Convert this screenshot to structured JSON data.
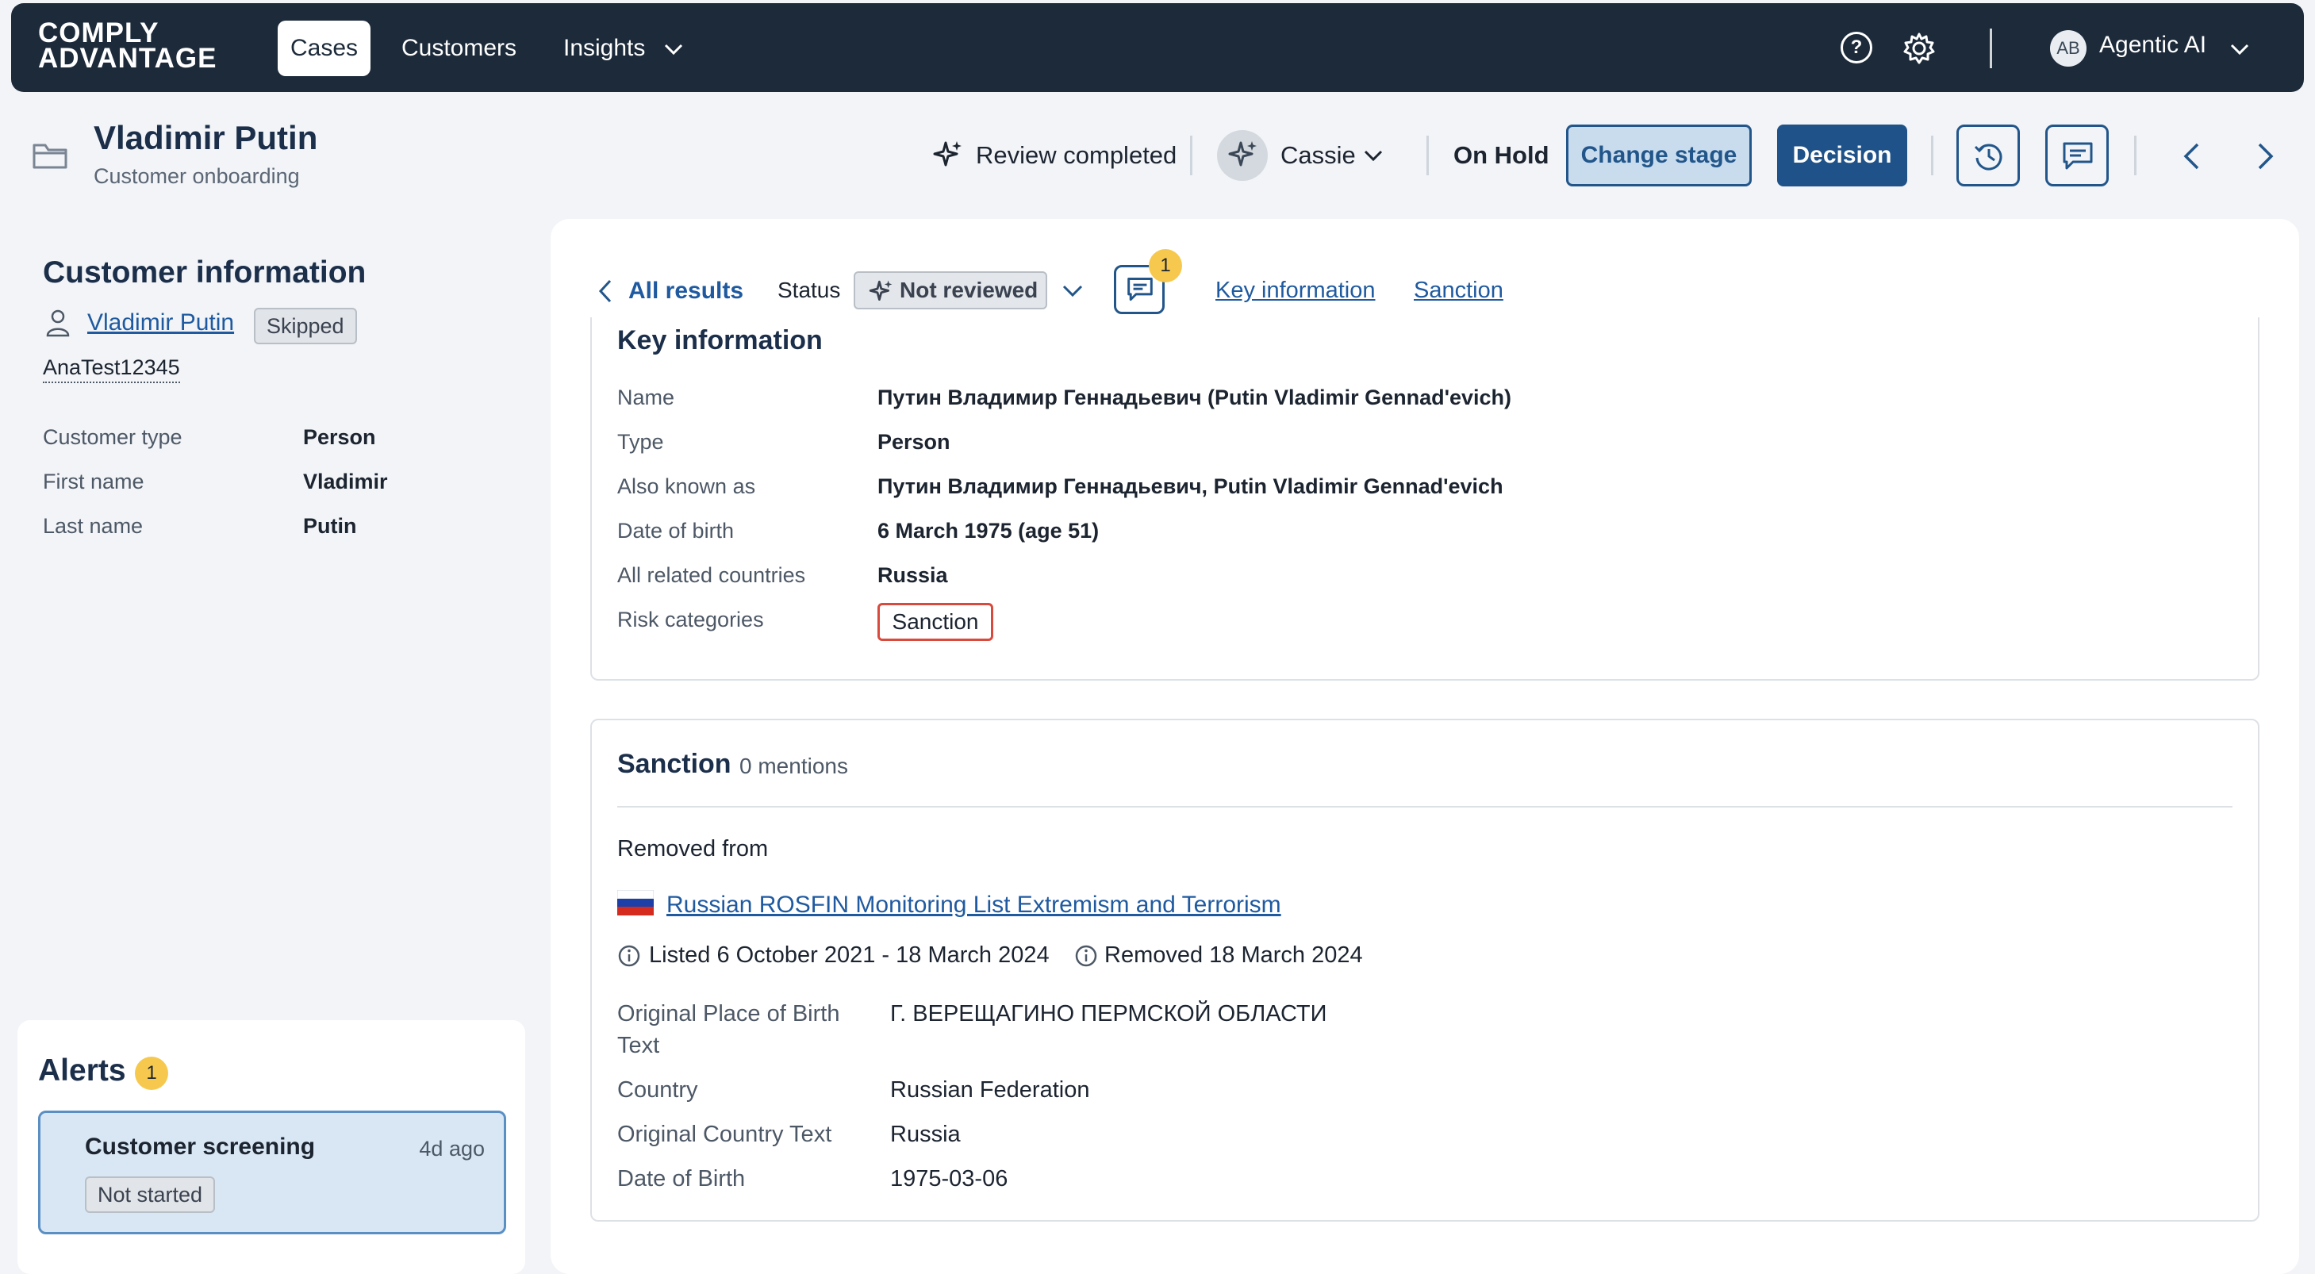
{
  "nav": {
    "logo_line1": "COMPLY",
    "logo_line2": "ADVANTAGE",
    "tabs": [
      {
        "label": "Cases",
        "active": true
      },
      {
        "label": "Customers",
        "active": false
      },
      {
        "label": "Insights",
        "active": false
      }
    ],
    "user": {
      "initials": "AB",
      "name": "Agentic AI"
    },
    "help_glyph": "?"
  },
  "case": {
    "title": "Vladimir Putin",
    "subtitle": "Customer onboarding",
    "review_status": "Review completed",
    "assignee": "Cassie",
    "stage": "On Hold",
    "change_stage_label": "Change stage",
    "decision_label": "Decision"
  },
  "customer_info": {
    "heading": "Customer information",
    "name": "Vladimir Putin",
    "name_status": "Skipped",
    "customer_id": "AnaTest12345",
    "fields": [
      {
        "label": "Customer type",
        "value": "Person"
      },
      {
        "label": "First name",
        "value": "Vladimir"
      },
      {
        "label": "Last name",
        "value": "Putin"
      }
    ]
  },
  "alerts": {
    "heading": "Alerts",
    "count": "1",
    "items": [
      {
        "title": "Customer screening",
        "age": "4d ago",
        "status": "Not started"
      }
    ]
  },
  "result_bar": {
    "back_label": "All results",
    "status_label": "Status",
    "status_value": "Not reviewed",
    "comment_count": "1",
    "anchor_links": [
      "Key information",
      "Sanction"
    ]
  },
  "key_information": {
    "heading": "Key information",
    "rows": [
      {
        "label": "Name",
        "value": "Путин Владимир Геннадьевич (Putin Vladimir Gennad'evich)"
      },
      {
        "label": "Type",
        "value": "Person"
      },
      {
        "label": "Also known as",
        "value": "Путин Владимир Геннадьевич, Putin Vladimir Gennad'evich"
      },
      {
        "label": "Date of birth",
        "value": "6 March 1975 (age 51)"
      },
      {
        "label": "All related countries",
        "value": "Russia"
      },
      {
        "label": "Risk categories",
        "value": "Sanction"
      }
    ]
  },
  "sanction": {
    "heading": "Sanction",
    "mentions": "0 mentions",
    "removed_from_label": "Removed from",
    "list_name": "Russian ROSFIN Monitoring List Extremism and Terrorism",
    "listed": "Listed 6 October 2021 - 18 March 2024",
    "removed": "Removed 18 March 2024",
    "details": [
      {
        "label_line1": "Original Place of Birth",
        "label_line2": "Text",
        "value": "Г. ВЕРЕЩАГИНО ПЕРМСКОЙ ОБЛАСТИ"
      },
      {
        "label_line1": "Country",
        "label_line2": "",
        "value": "Russian Federation"
      },
      {
        "label_line1": "Original Country Text",
        "label_line2": "",
        "value": "Russia"
      },
      {
        "label_line1": "Date of Birth",
        "label_line2": "",
        "value": "1975-03-06"
      }
    ]
  }
}
